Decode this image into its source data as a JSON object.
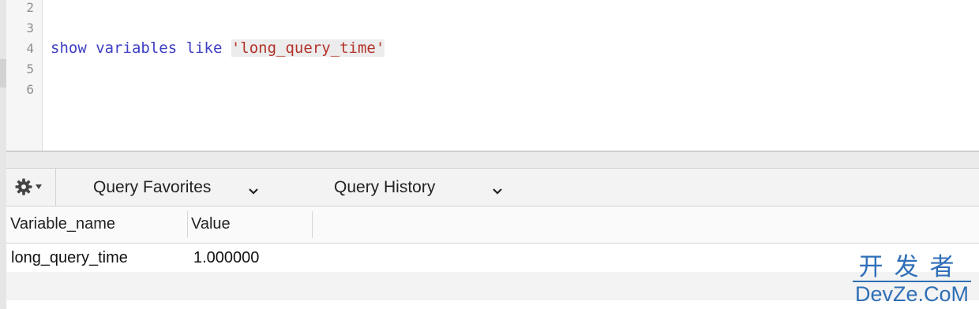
{
  "editor": {
    "lines": [
      {
        "number": "2",
        "text": ""
      },
      {
        "number": "3",
        "text": ""
      },
      {
        "number": "4",
        "text": "show variables like 'long_query_time'"
      },
      {
        "number": "5",
        "text": ""
      },
      {
        "number": "6",
        "text": ""
      }
    ],
    "query": {
      "kw1": "show",
      "kw2": "variables",
      "kw3": "like",
      "string": "'long_query_time'"
    }
  },
  "toolbar": {
    "gear_icon": "gear-icon",
    "favorites_label": "Query Favorites",
    "history_label": "Query History"
  },
  "results": {
    "columns": [
      "Variable_name",
      "Value"
    ],
    "rows": [
      [
        "long_query_time",
        "1.000000"
      ]
    ]
  },
  "watermark": {
    "cn": "开发者",
    "en": "DevZe.CoM"
  },
  "colors": {
    "keyword": "#3e3ec4",
    "string": "#b3322a",
    "watermark": "#2f6fb7"
  }
}
